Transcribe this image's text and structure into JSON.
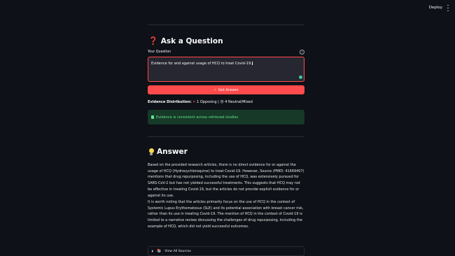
{
  "topbar": {
    "deploy_label": "Deploy"
  },
  "ask": {
    "heading": "Ask a Question",
    "heading_icon": "red-question-mark",
    "field_label": "Your Question",
    "question_value": "Evidence for and against usage of HCQ to treat Covid-19.",
    "submit_label": "Get Answer",
    "submit_icon": "lightning-bolt"
  },
  "distribution": {
    "label": "Evidence Distribution:",
    "opposing": "1 Opposing",
    "separator": " | ",
    "neutral": "4 Neutral/Mixed",
    "opposing_icon": "cross-mark",
    "neutral_icon": "neutral-face"
  },
  "alert": {
    "text": "Evidence is consistent across retrieved studies",
    "icon": "document-icon"
  },
  "answer": {
    "heading": "Answer",
    "heading_icon": "light-bulb",
    "paragraphs": [
      "Based on the provided research articles, there is no direct evidence for or against the usage of HCQ (Hydroxychloroquine) to treat Covid-19. However, Source (PMID: 41669407) mentions that drug repurposing, including the use of HCQ, was extensively pursued for SARS-CoV-2 but has not yielded successful treatments. This suggests that HCQ may not be effective in treating Covid-19, but the articles do not provide explicit evidence for or against its use.",
      "It is worth noting that the articles primarily focus on the use of HCQ in the context of Systemic Lupus Erythematosus (SLE) and its potential association with breast cancer risk, rather than its use in treating Covid-19. The mention of HCQ in the context of Covid-19 is limited to a narrative review discussing the challenges of drug repurposing, including the example of HCQ, which did not yield successful outcomes."
    ]
  },
  "sources": {
    "label": "View All Sources",
    "icon": "books-icon"
  },
  "colors": {
    "background": "#0e1117",
    "accent": "#ff4b4b",
    "success_bg": "#173928",
    "success_text": "#5ce488"
  }
}
